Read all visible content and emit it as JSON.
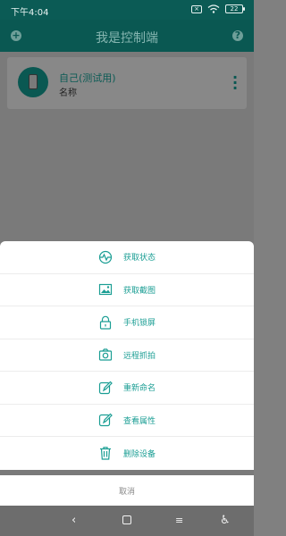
{
  "status_bar": {
    "time": "下午4:04",
    "battery": "22"
  },
  "app_bar": {
    "title": "我是控制端"
  },
  "device": {
    "name": "自己(测试用)",
    "subtitle": "名称"
  },
  "sheet": {
    "items": [
      {
        "label": "获取状态",
        "icon": "status-pulse-icon"
      },
      {
        "label": "获取截图",
        "icon": "image-icon"
      },
      {
        "label": "手机锁屏",
        "icon": "lock-icon"
      },
      {
        "label": "远程抓拍",
        "icon": "camera-icon"
      },
      {
        "label": "重新命名",
        "icon": "edit-icon"
      },
      {
        "label": "查看属性",
        "icon": "edit-properties-icon"
      },
      {
        "label": "删除设备",
        "icon": "trash-icon"
      }
    ],
    "cancel_label": "取消"
  },
  "accent_color": "#1b9e94"
}
